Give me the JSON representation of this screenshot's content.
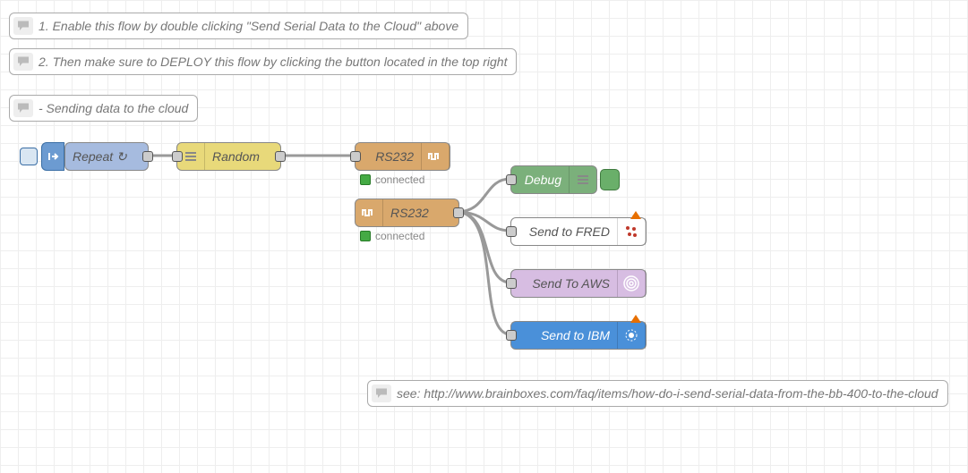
{
  "comments": {
    "c1": "1. Enable this flow by double clicking \"Send Serial Data to the Cloud\" above",
    "c2": "2. Then make sure to DEPLOY this flow by clicking the button located in the top right",
    "c3": "- Sending data to the cloud",
    "c4": "see: http://www.brainboxes.com/faq/items/how-do-i-send-serial-data-from-the-bb-400-to-the-cloud"
  },
  "nodes": {
    "repeat": {
      "label": "Repeat ↻"
    },
    "random": {
      "label": "Random"
    },
    "rs232_out": {
      "label": "RS232",
      "status": "connected"
    },
    "rs232_in": {
      "label": "RS232",
      "status": "connected"
    },
    "debug": {
      "label": "Debug"
    },
    "send_fred": {
      "label": "Send to FRED"
    },
    "send_aws": {
      "label": "Send To AWS"
    },
    "send_ibm": {
      "label": "Send to IBM"
    }
  }
}
